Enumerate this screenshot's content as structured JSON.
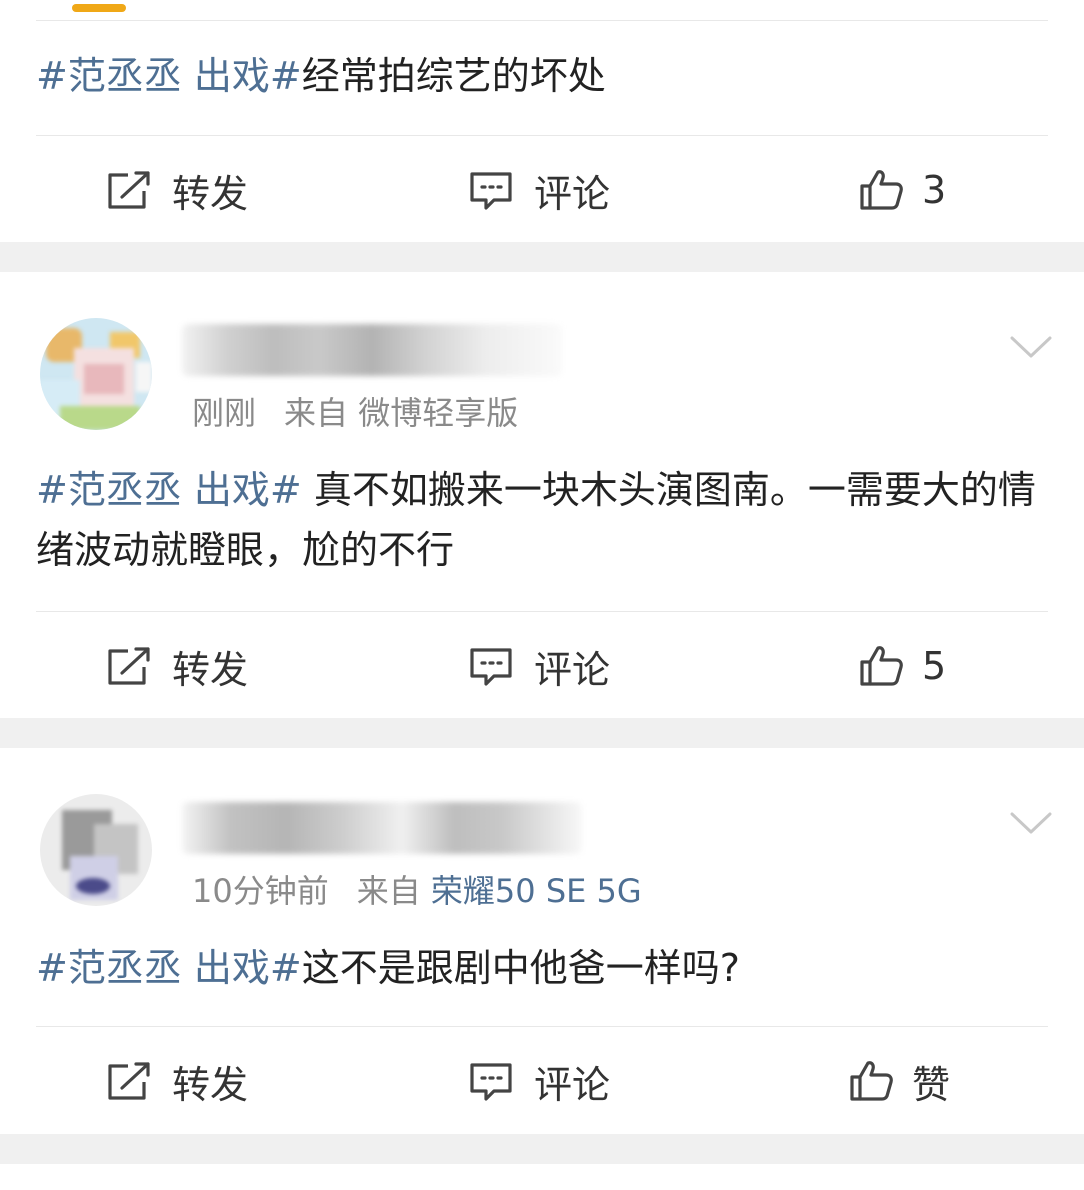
{
  "posts": [
    {
      "topic": "#范丞丞 出戏#",
      "text": "经常拍综艺的坏处",
      "actions": {
        "repost": "转发",
        "comment": "评论",
        "like": "3"
      }
    },
    {
      "time": "刚刚",
      "from_label": "来自",
      "source": "微博轻享版",
      "topic": "#范丞丞 出戏#",
      "text": " 真不如搬来一块木头演图南。一需要大的情绪波动就瞪眼，尬的不行",
      "actions": {
        "repost": "转发",
        "comment": "评论",
        "like": "5"
      }
    },
    {
      "time": "10分钟前",
      "from_label": "来自",
      "source": "荣耀50 SE 5G",
      "topic": "#范丞丞 出戏#",
      "text": "这不是跟剧中他爸一样吗?",
      "actions": {
        "repost": "转发",
        "comment": "评论",
        "like": "赞"
      }
    }
  ],
  "icons": {
    "repost": "repost-icon",
    "comment": "comment-icon",
    "like": "thumbs-up-icon",
    "more": "chevron-down-icon"
  },
  "colors": {
    "topic_link": "#4e6f93",
    "accent_bar": "#f0a817",
    "separator": "#f0f0f0"
  }
}
